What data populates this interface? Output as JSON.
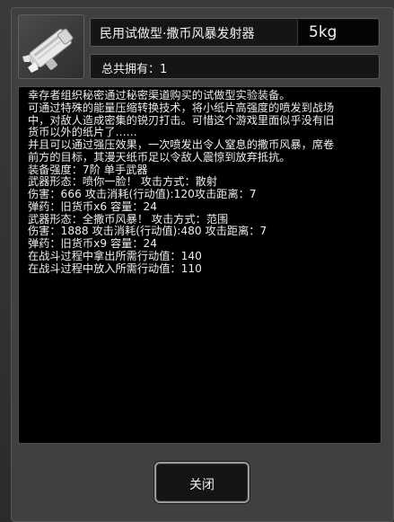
{
  "dialog": {
    "item_name": "民用试做型·撒币风暴发射器",
    "weight": "5kg",
    "owned": "总共拥有：1",
    "close_label": "关闭",
    "icon": "banknote-launcher-icon",
    "description_lines": [
      "幸存者组织秘密通过秘密渠道购买的试做型实验装备。",
      "可通过特殊的能量压缩转换技术，将小纸片高强度的喷发到战场",
      "中，对敌人造成密集的锐刃打击。可惜这个游戏里面似乎没有旧",
      "货币以外的纸片了……",
      "并且可以通过强压效果，一次喷发出令人窒息的撒币风暴，席卷",
      "前方的目标，其漫天纸币足以令敌人震惊到放弃抵抗。",
      "装备强度：7阶 单手武器",
      "武器形态：喷你一脸！ 攻击方式：散射",
      "伤害：666 攻击消耗(行动值):120攻击距离：7",
      "弹药：旧货币x6 容量：24",
      "武器形态：全撒币风暴！ 攻击方式：范围",
      "伤害：1888 攻击消耗(行动值):480 攻击距离：7",
      "弹药：旧货币x9 容量：24",
      "在战斗过程中拿出所需行动值：140",
      "在战斗过程中放入所需行动值：110"
    ]
  }
}
